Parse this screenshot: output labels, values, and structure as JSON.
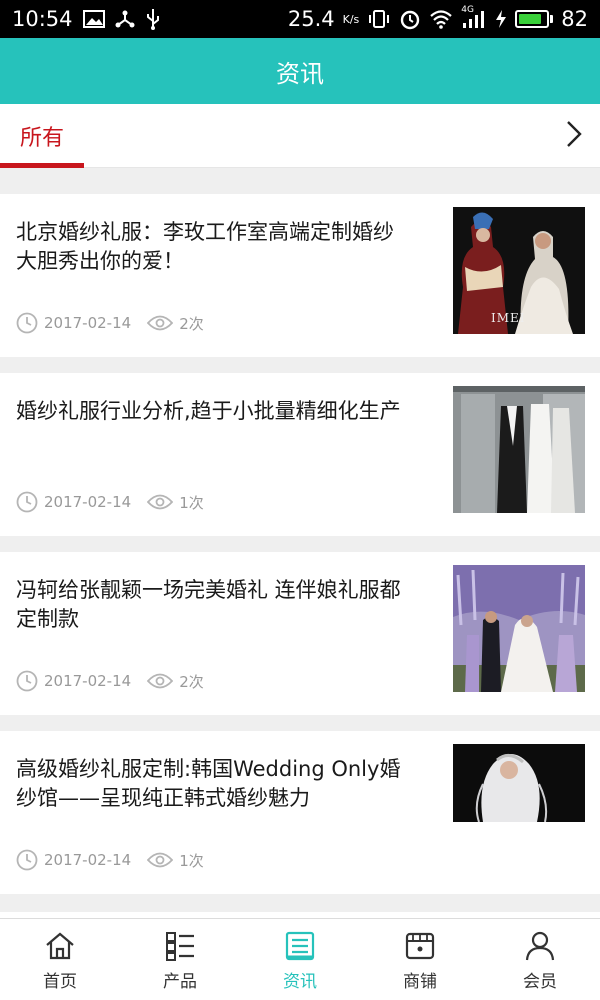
{
  "status_bar": {
    "time": "10:54",
    "speed": "25.4",
    "speed_unit": "K/s",
    "network": "4G",
    "battery_level": "82",
    "battery_fraction": 0.82,
    "battery_color": "#3ad13a"
  },
  "header": {
    "title": "资讯"
  },
  "tabs": {
    "active_label": "所有",
    "accent": "#c8161d"
  },
  "articles": [
    {
      "title": "北京婚纱礼服：李玫工作室高端定制婚纱 大胆秀出你的爱！",
      "date": "2017-02-14",
      "views": "2次",
      "thumb_icon": "photo-thumbnail",
      "thumb_caption": "IMEI"
    },
    {
      "title": "婚纱礼服行业分析,趋于小批量精细化生产",
      "date": "2017-02-14",
      "views": "1次",
      "thumb_icon": "photo-thumbnail"
    },
    {
      "title": "冯轲给张靓颖一场完美婚礼 连伴娘礼服都定制款",
      "date": "2017-02-14",
      "views": "2次",
      "thumb_icon": "photo-thumbnail"
    },
    {
      "title": "高级婚纱礼服定制:韩国Wedding Only婚纱馆——呈现纯正韩式婚纱魅力",
      "date": "2017-02-14",
      "views": "1次",
      "thumb_icon": "photo-thumbnail"
    }
  ],
  "nav": [
    {
      "label": "首页",
      "icon": "home-icon"
    },
    {
      "label": "产品",
      "icon": "product-list-icon"
    },
    {
      "label": "资讯",
      "icon": "news-icon",
      "active": true
    },
    {
      "label": "商铺",
      "icon": "store-icon"
    },
    {
      "label": "会员",
      "icon": "user-icon"
    }
  ],
  "colors": {
    "accent": "#26c2bb",
    "tab_accent": "#c8161d"
  }
}
